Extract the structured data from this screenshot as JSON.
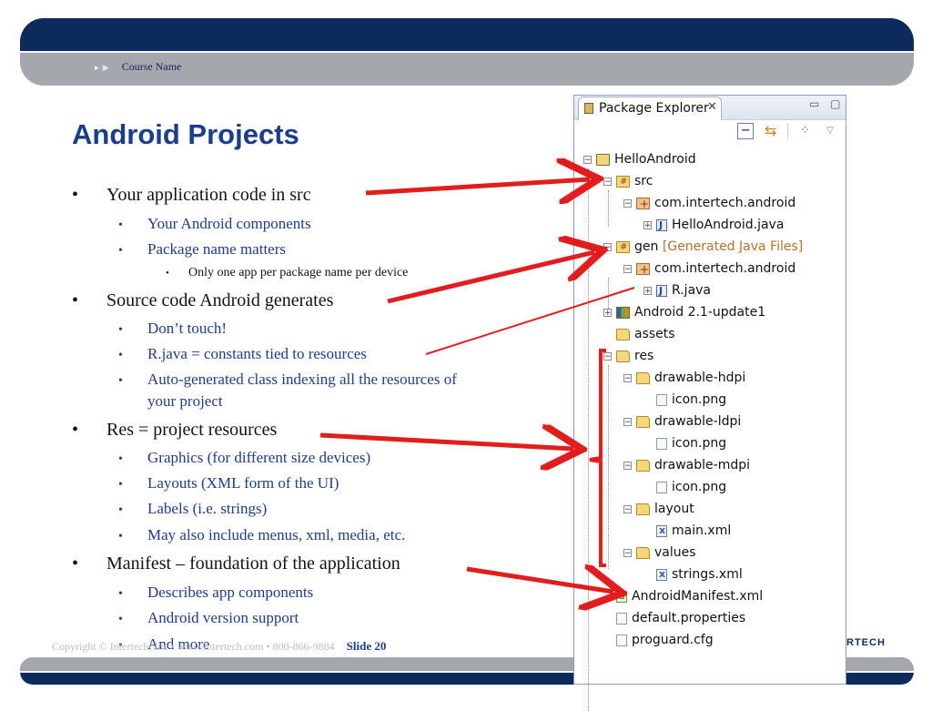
{
  "header": {
    "course_name": "Course Name"
  },
  "slide": {
    "title": "Android Projects",
    "bullets": [
      {
        "level": 1,
        "text": "Your application code in src"
      },
      {
        "level": 2,
        "text": "Your Android components"
      },
      {
        "level": 2,
        "text": "Package name matters"
      },
      {
        "level": 3,
        "text": "Only one app per package name per device"
      },
      {
        "level": 1,
        "text": "Source code Android generates"
      },
      {
        "level": 2,
        "text": "Don’t touch!"
      },
      {
        "level": 2,
        "text": "R.java = constants tied to resources"
      },
      {
        "level": 2,
        "text": "Auto-generated class indexing all the resources of"
      },
      {
        "level": 2,
        "text": "your project",
        "continuation": true
      },
      {
        "level": 1,
        "text": "Res = project resources"
      },
      {
        "level": 2,
        "text": "Graphics (for different size devices)"
      },
      {
        "level": 2,
        "text": "Layouts (XML form of the UI)"
      },
      {
        "level": 2,
        "text": "Labels (i.e. strings)"
      },
      {
        "level": 2,
        "text": "May also include menus, xml, media, etc."
      },
      {
        "level": 1,
        "text": "Manifest – foundation of the application"
      },
      {
        "level": 2,
        "text": "Describes app components"
      },
      {
        "level": 2,
        "text": "Android version support"
      },
      {
        "level": 2,
        "text": "And more"
      }
    ],
    "bullet_glyph": "•"
  },
  "footer": {
    "copyright": "Copyright © Intertech, Inc • www.Intertech.com • 800-866-9884",
    "slide_label": "Slide 20",
    "logo_text": "RTECH"
  },
  "package_explorer": {
    "tab_label": "Package Explorer",
    "tab_close": "✕",
    "window_buttons": "▭ ▢",
    "toolbar": {
      "collapse_glyph": "−",
      "link_glyph": "⇆",
      "filter_glyph": "⁘",
      "menu_glyph": "▽"
    },
    "tree": [
      {
        "label": "HelloAndroid",
        "depth": 0,
        "expander": "−",
        "icon": "project"
      },
      {
        "label": "src",
        "depth": 1,
        "expander": "−",
        "icon": "source-folder"
      },
      {
        "label": "com.intertech.android",
        "depth": 2,
        "expander": "−",
        "icon": "package"
      },
      {
        "label": "HelloAndroid.java",
        "depth": 3,
        "expander": "+",
        "icon": "java-file"
      },
      {
        "label": "gen",
        "note": "[Generated Java Files]",
        "depth": 1,
        "expander": "−",
        "icon": "source-folder"
      },
      {
        "label": "com.intertech.android",
        "depth": 2,
        "expander": "−",
        "icon": "package"
      },
      {
        "label": "R.java",
        "depth": 3,
        "expander": "+",
        "icon": "java-file"
      },
      {
        "label": "Android 2.1-update1",
        "depth": 1,
        "expander": "+",
        "icon": "library"
      },
      {
        "label": "assets",
        "depth": 1,
        "expander": "",
        "icon": "folder"
      },
      {
        "label": "res",
        "depth": 1,
        "expander": "−",
        "icon": "folder"
      },
      {
        "label": "drawable-hdpi",
        "depth": 2,
        "expander": "−",
        "icon": "folder"
      },
      {
        "label": "icon.png",
        "depth": 3,
        "expander": "",
        "icon": "file"
      },
      {
        "label": "drawable-ldpi",
        "depth": 2,
        "expander": "−",
        "icon": "folder"
      },
      {
        "label": "icon.png",
        "depth": 3,
        "expander": "",
        "icon": "file"
      },
      {
        "label": "drawable-mdpi",
        "depth": 2,
        "expander": "−",
        "icon": "folder"
      },
      {
        "label": "icon.png",
        "depth": 3,
        "expander": "",
        "icon": "file"
      },
      {
        "label": "layout",
        "depth": 2,
        "expander": "−",
        "icon": "folder"
      },
      {
        "label": "main.xml",
        "depth": 3,
        "expander": "",
        "icon": "xml-file"
      },
      {
        "label": "values",
        "depth": 2,
        "expander": "−",
        "icon": "folder"
      },
      {
        "label": "strings.xml",
        "depth": 3,
        "expander": "",
        "icon": "xml-file"
      },
      {
        "label": "AndroidManifest.xml",
        "depth": 1,
        "expander": "",
        "icon": "manifest-file"
      },
      {
        "label": "default.properties",
        "depth": 1,
        "expander": "",
        "icon": "file"
      },
      {
        "label": "proguard.cfg",
        "depth": 1,
        "expander": "",
        "icon": "file"
      }
    ]
  },
  "colors": {
    "navy": "#0c2a5b",
    "title_blue": "#1b3d8e",
    "sub_bullet_blue": "#1f3b8a",
    "arrow_red": "#e21d1d",
    "banner_gray": "#a4a7ac"
  }
}
